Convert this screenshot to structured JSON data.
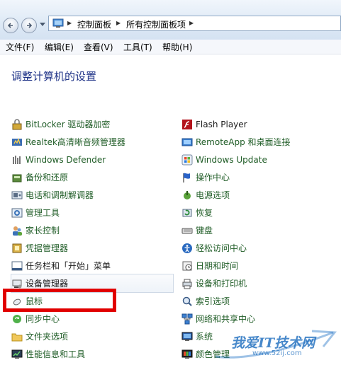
{
  "address": {
    "crumbs": [
      "控制面板",
      "所有控制面板项"
    ]
  },
  "menu": [
    "文件(F)",
    "编辑(E)",
    "查看(V)",
    "工具(T)",
    "帮助(H)"
  ],
  "page_title": "调整计算机的设置",
  "left_items": [
    {
      "label": "BitLocker 驱动器加密",
      "icon": "bitlocker-icon"
    },
    {
      "label": "Realtek高清晰音频管理器",
      "icon": "realtek-audio-icon"
    },
    {
      "label": "Windows Defender",
      "icon": "defender-icon"
    },
    {
      "label": "备份和还原",
      "icon": "backup-icon"
    },
    {
      "label": "电话和调制解调器",
      "icon": "phone-modem-icon"
    },
    {
      "label": "管理工具",
      "icon": "admin-tools-icon"
    },
    {
      "label": "家长控制",
      "icon": "parental-control-icon"
    },
    {
      "label": "凭据管理器",
      "icon": "credential-icon"
    },
    {
      "label": "任务栏和「开始」菜单",
      "icon": "taskbar-icon"
    },
    {
      "label": "设备管理器",
      "icon": "device-manager-icon"
    },
    {
      "label": "鼠标",
      "icon": "mouse-icon"
    },
    {
      "label": "同步中心",
      "icon": "sync-icon"
    },
    {
      "label": "文件夹选项",
      "icon": "folder-icon"
    },
    {
      "label": "性能信息和工具",
      "icon": "performance-icon"
    }
  ],
  "right_items": [
    {
      "label": "Flash Player",
      "icon": "flash-icon"
    },
    {
      "label": "RemoteApp 和桌面连接",
      "icon": "remoteapp-icon"
    },
    {
      "label": "Windows Update",
      "icon": "windows-update-icon"
    },
    {
      "label": "操作中心",
      "icon": "flag-icon"
    },
    {
      "label": "电源选项",
      "icon": "power-icon"
    },
    {
      "label": "恢复",
      "icon": "recovery-icon"
    },
    {
      "label": "键盘",
      "icon": "keyboard-icon"
    },
    {
      "label": "轻松访问中心",
      "icon": "ease-access-icon"
    },
    {
      "label": "日期和时间",
      "icon": "clock-icon"
    },
    {
      "label": "设备和打印机",
      "icon": "printer-icon"
    },
    {
      "label": "索引选项",
      "icon": "index-icon"
    },
    {
      "label": "网络和共享中心",
      "icon": "network-icon"
    },
    {
      "label": "系统",
      "icon": "system-icon"
    },
    {
      "label": "颜色管理",
      "icon": "color-management-icon"
    }
  ],
  "watermark": {
    "text": "我爱IT技术网",
    "url": "www.52ij.com"
  },
  "colors": {
    "link": "#1f5c26",
    "title": "#1e3287",
    "highlight": "#e10000"
  }
}
